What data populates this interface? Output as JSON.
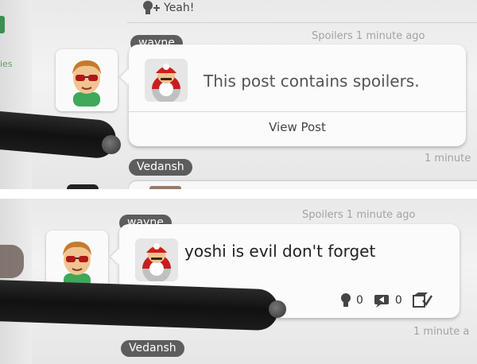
{
  "top": {
    "yeah_label": "Yeah!",
    "left_fragment": "ies",
    "post": {
      "username": "wayne",
      "meta": "Spoilers 1 minute ago",
      "body": "This post contains spoilers.",
      "view_label": "View Post"
    },
    "next_post": {
      "username": "Vedansh",
      "meta": "1 minute"
    }
  },
  "bottom": {
    "post": {
      "username": "wayne",
      "meta": "Spoilers 1 minute ago",
      "body": "yoshi is evil don't forget",
      "yeah_count": "0",
      "reply_count": "0"
    },
    "next_post": {
      "username": "Vedansh",
      "meta": "1 minute a"
    }
  },
  "icons": [
    "yeah-icon",
    "reply-icon",
    "spoiler-icon"
  ],
  "colors": {
    "name_tag": "#5d5d5d",
    "meta_text": "#a3a3a3",
    "card": "#fbfbfb"
  }
}
